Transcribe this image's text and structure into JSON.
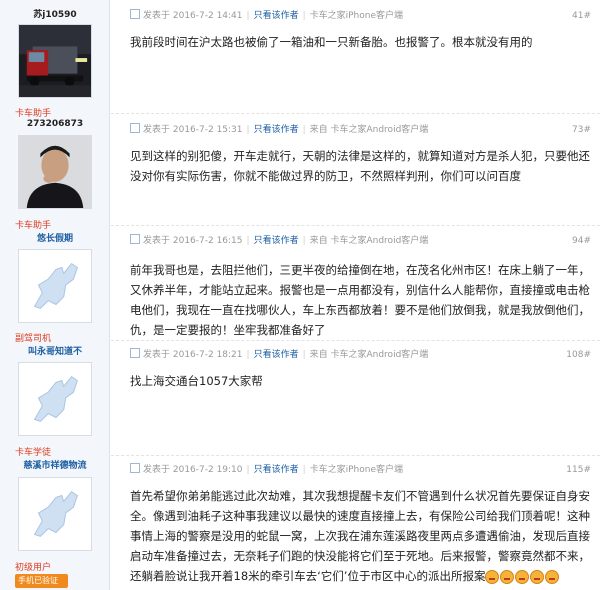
{
  "sidebar": {
    "users": [
      {
        "role": "",
        "name": "苏j10590",
        "name_link": false
      },
      {
        "role": "卡车助手",
        "name": "273206873",
        "name_link": false
      },
      {
        "role": "卡车助手",
        "name": "悠长假期",
        "name_link": true
      },
      {
        "role": "副驾司机",
        "name": "叫永哥知道不",
        "name_link": true
      },
      {
        "role": "卡车学徒",
        "name": "慈溪市祥德物流",
        "name_link": true
      },
      {
        "role": "初级用户",
        "name": "",
        "name_link": false
      }
    ],
    "phone_badge": "手机已验证"
  },
  "posts": [
    {
      "date": "发表于 2016-7-2 14:41",
      "author_only": "只看该作者",
      "source": "卡车之家iPhone客户端",
      "floor": "41#",
      "content": "我前段时间在沪太路也被偷了一箱油和一只新备胎。也报警了。根本就没有用的"
    },
    {
      "date": "发表于 2016-7-2 15:31",
      "author_only": "只看该作者",
      "source": "来自 卡车之家Android客户端",
      "floor": "73#",
      "content": "见到这样的别犯傻，开车走就行，天朝的法律是这样的，就算知道对方是杀人犯，只要他还没对你有实际伤害，你就不能做过界的防卫，不然照样判刑，你们可以问百度"
    },
    {
      "date": "发表于 2016-7-2 16:15",
      "author_only": "只看该作者",
      "source": "来自 卡车之家Android客户端",
      "floor": "94#",
      "content": "前年我哥也是，去阻拦他们，三更半夜的给撞倒在地，在茂名化州市区！在床上躺了一年，又休养半年，才能站立起来。报警也是一点用都没有，别信什么人能帮你，直接撞或电击枪电他们，我现在一直在找哪伙人，车上东西都放着！要不是他们放倒我，就是我放倒他们，仇，是一定要报的！坐牢我都准备好了"
    },
    {
      "date": "发表于 2016-7-2 18:21",
      "author_only": "只看该作者",
      "source": "来自 卡车之家Android客户端",
      "floor": "108#",
      "content": "找上海交通台1057大家帮"
    },
    {
      "date": "发表于 2016-7-2 19:10",
      "author_only": "只看该作者",
      "source": "卡车之家iPhone客户端",
      "floor": "115#",
      "content": "首先希望你弟弟能逃过此次劫难，其次我想提醒卡友们不管遇到什么状况首先要保证自身安全。像遇到油耗子这种事我建议以最快的速度直接撞上去，有保险公司给我们顶着呢！这种事情上海的警察是没用的蛇鼠一窝，上次我在浦东莲溪路夜里两点多遭遇偷油，发现后直接启动车准备撞过去，无奈耗子们跑的快没能将它们至于死地。后来报警，警察竟然都不来，还躺着脸说让我开着18米的牵引车去‘它们’位于市区中心的派出所报案"
    }
  ],
  "emoji_icon": "angry-face-icon",
  "emoji_count": 5
}
